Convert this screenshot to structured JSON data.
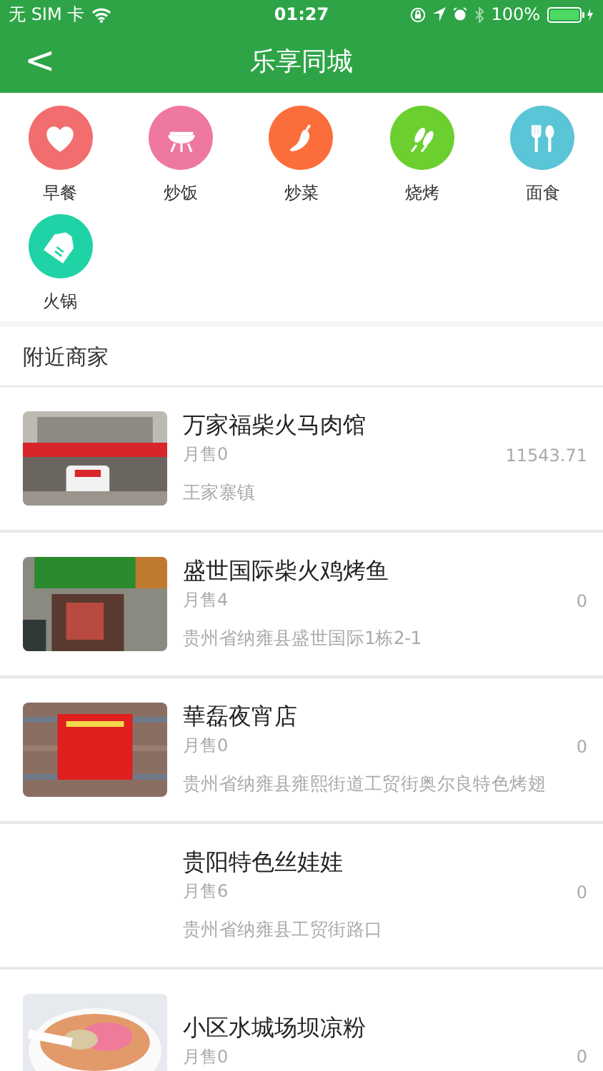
{
  "status_bar": {
    "carrier": "无 SIM 卡",
    "time": "01:27",
    "battery": "100%"
  },
  "nav": {
    "back": "<",
    "title": "乐享同城"
  },
  "categories": [
    {
      "label": "早餐",
      "color": "#f26d6d"
    },
    {
      "label": "炒饭",
      "color": "#ef78a2"
    },
    {
      "label": "炒菜",
      "color": "#fb6d3a"
    },
    {
      "label": "烧烤",
      "color": "#6ccf30"
    },
    {
      "label": "面食",
      "color": "#5ac5d6"
    },
    {
      "label": "火锅",
      "color": "#1fd3a6"
    }
  ],
  "section_title": "附近商家",
  "shops": [
    {
      "name": "万家福柴火马肉馆",
      "sales": "月售0",
      "amount": "11543.71",
      "address": "王家寨镇",
      "picture": true
    },
    {
      "name": "盛世国际柴火鸡烤鱼",
      "sales": "月售4",
      "amount": "0",
      "address": "贵州省纳雍县盛世国际1栋2-1",
      "picture": true
    },
    {
      "name": "華磊夜宵店",
      "sales": "月售0",
      "amount": "0",
      "address": "贵州省纳雍县雍熙街道工贸街奥尔良特色烤翅",
      "picture": true
    },
    {
      "name": "贵阳特色丝娃娃",
      "sales": "月售6",
      "amount": "0",
      "address": "贵州省纳雍县工贸街路口",
      "picture": false
    },
    {
      "name": "小区水城场坝凉粉",
      "sales": "月售0",
      "amount": "0",
      "picture": true
    }
  ]
}
